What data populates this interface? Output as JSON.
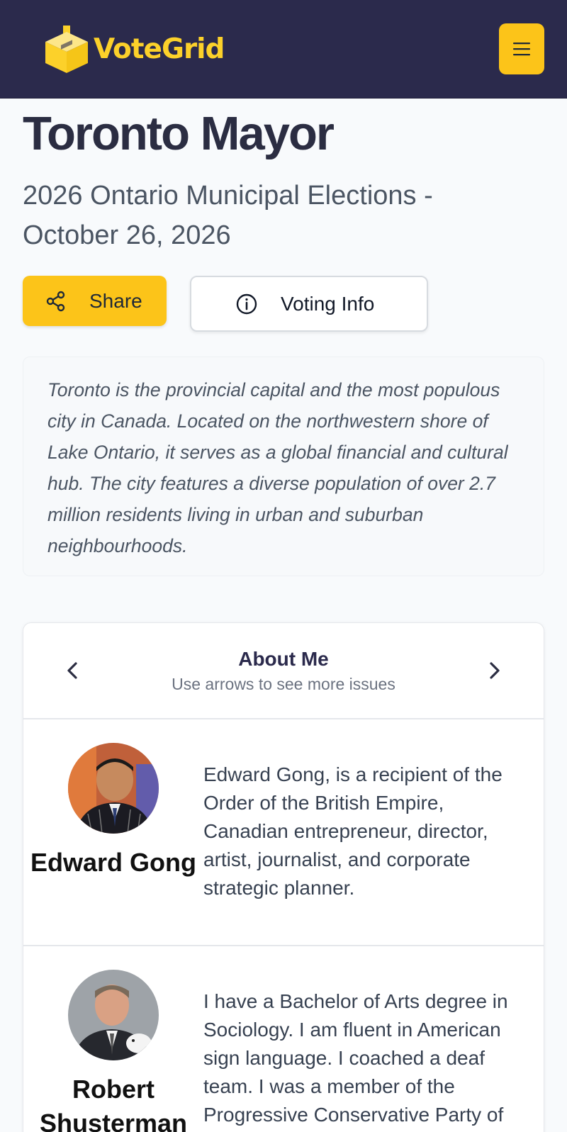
{
  "header": {
    "brand_name": "VoteGrid",
    "menu_icon": "hamburger-icon"
  },
  "race": {
    "title": "Toronto Mayor",
    "subtitle": "2026 Ontario Municipal Elections - October 26, 2026"
  },
  "actions": {
    "share_label": "Share",
    "voting_info_label": "Voting Info"
  },
  "description": "Toronto is the provincial capital and the most populous city in Canada. Located on the northwestern shore of Lake Ontario, it serves as a global financial and cultural hub. The city features a diverse population of over 2.7 million residents living in urban and suburban neighbourhoods.",
  "issues": {
    "title": "About Me",
    "hint": "Use arrows to see more issues"
  },
  "candidates": [
    {
      "name": "Edward Gong",
      "bio": "Edward Gong, is a recipient of the Order of the British Empire, Canadian entrepreneur, director, artist, journalist, and corporate strategic planner."
    },
    {
      "name": "Robert Shusterman",
      "bio": "I have a Bachelor of Arts degree in Sociology. I am fluent in American sign language. I coached a deaf team. I was a member of the Progressive Conservative Party of Ontario."
    }
  ],
  "colors": {
    "header_bg": "#2b2a4c",
    "accent": "#fcc419",
    "brand_text": "#fcd12a"
  }
}
